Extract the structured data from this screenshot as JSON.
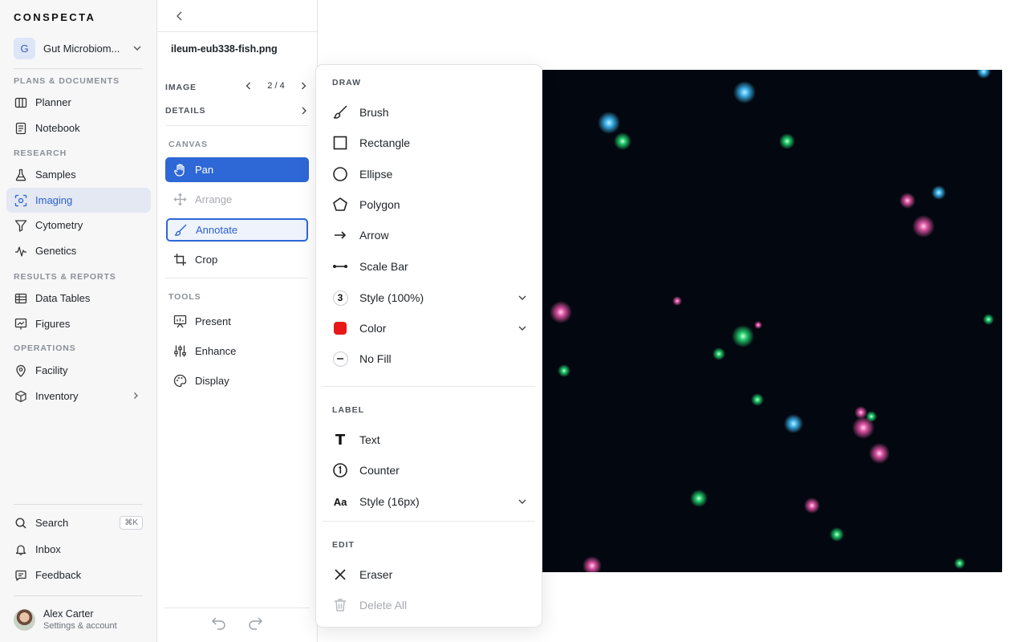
{
  "brand": "CONSPECTA",
  "workspace": {
    "initial": "G",
    "name": "Gut Microbiom..."
  },
  "nav": {
    "sec_plans": "PLANS & DOCUMENTS",
    "planner": "Planner",
    "notebook": "Notebook",
    "sec_research": "RESEARCH",
    "samples": "Samples",
    "imaging": "Imaging",
    "cytometry": "Cytometry",
    "genetics": "Genetics",
    "sec_results": "RESULTS & REPORTS",
    "data_tables": "Data Tables",
    "figures": "Figures",
    "sec_operations": "OPERATIONS",
    "facility": "Facility",
    "inventory": "Inventory",
    "search": "Search",
    "search_shortcut": "⌘K",
    "inbox": "Inbox",
    "feedback": "Feedback"
  },
  "user": {
    "name": "Alex Carter",
    "subtitle": "Settings & account"
  },
  "panel": {
    "file_name": "ileum-eub338-fish.png",
    "image_label": "IMAGE",
    "page": "2 / 4",
    "details_label": "DETAILS",
    "canvas_label": "CANVAS",
    "pan": "Pan",
    "arrange": "Arrange",
    "annotate": "Annotate",
    "crop": "Crop",
    "tools_label": "TOOLS",
    "present": "Present",
    "enhance": "Enhance",
    "display": "Display"
  },
  "menu": {
    "draw_label": "DRAW",
    "brush": "Brush",
    "rectangle": "Rectangle",
    "ellipse": "Ellipse",
    "polygon": "Polygon",
    "arrow": "Arrow",
    "scale_bar": "Scale Bar",
    "style_badge": "3",
    "style_stroke": "Style (100%)",
    "color": "Color",
    "color_value": "#e81818",
    "no_fill": "No Fill",
    "label_label": "LABEL",
    "text": "Text",
    "text_glyph": "T",
    "counter": "Counter",
    "style_font_badge": "Aa",
    "style_font": "Style (16px)",
    "edit_label": "EDIT",
    "eraser": "Eraser",
    "delete_all": "Delete All"
  },
  "colors": {
    "accent": "#2e67d6",
    "image_bg": "#03070f"
  }
}
